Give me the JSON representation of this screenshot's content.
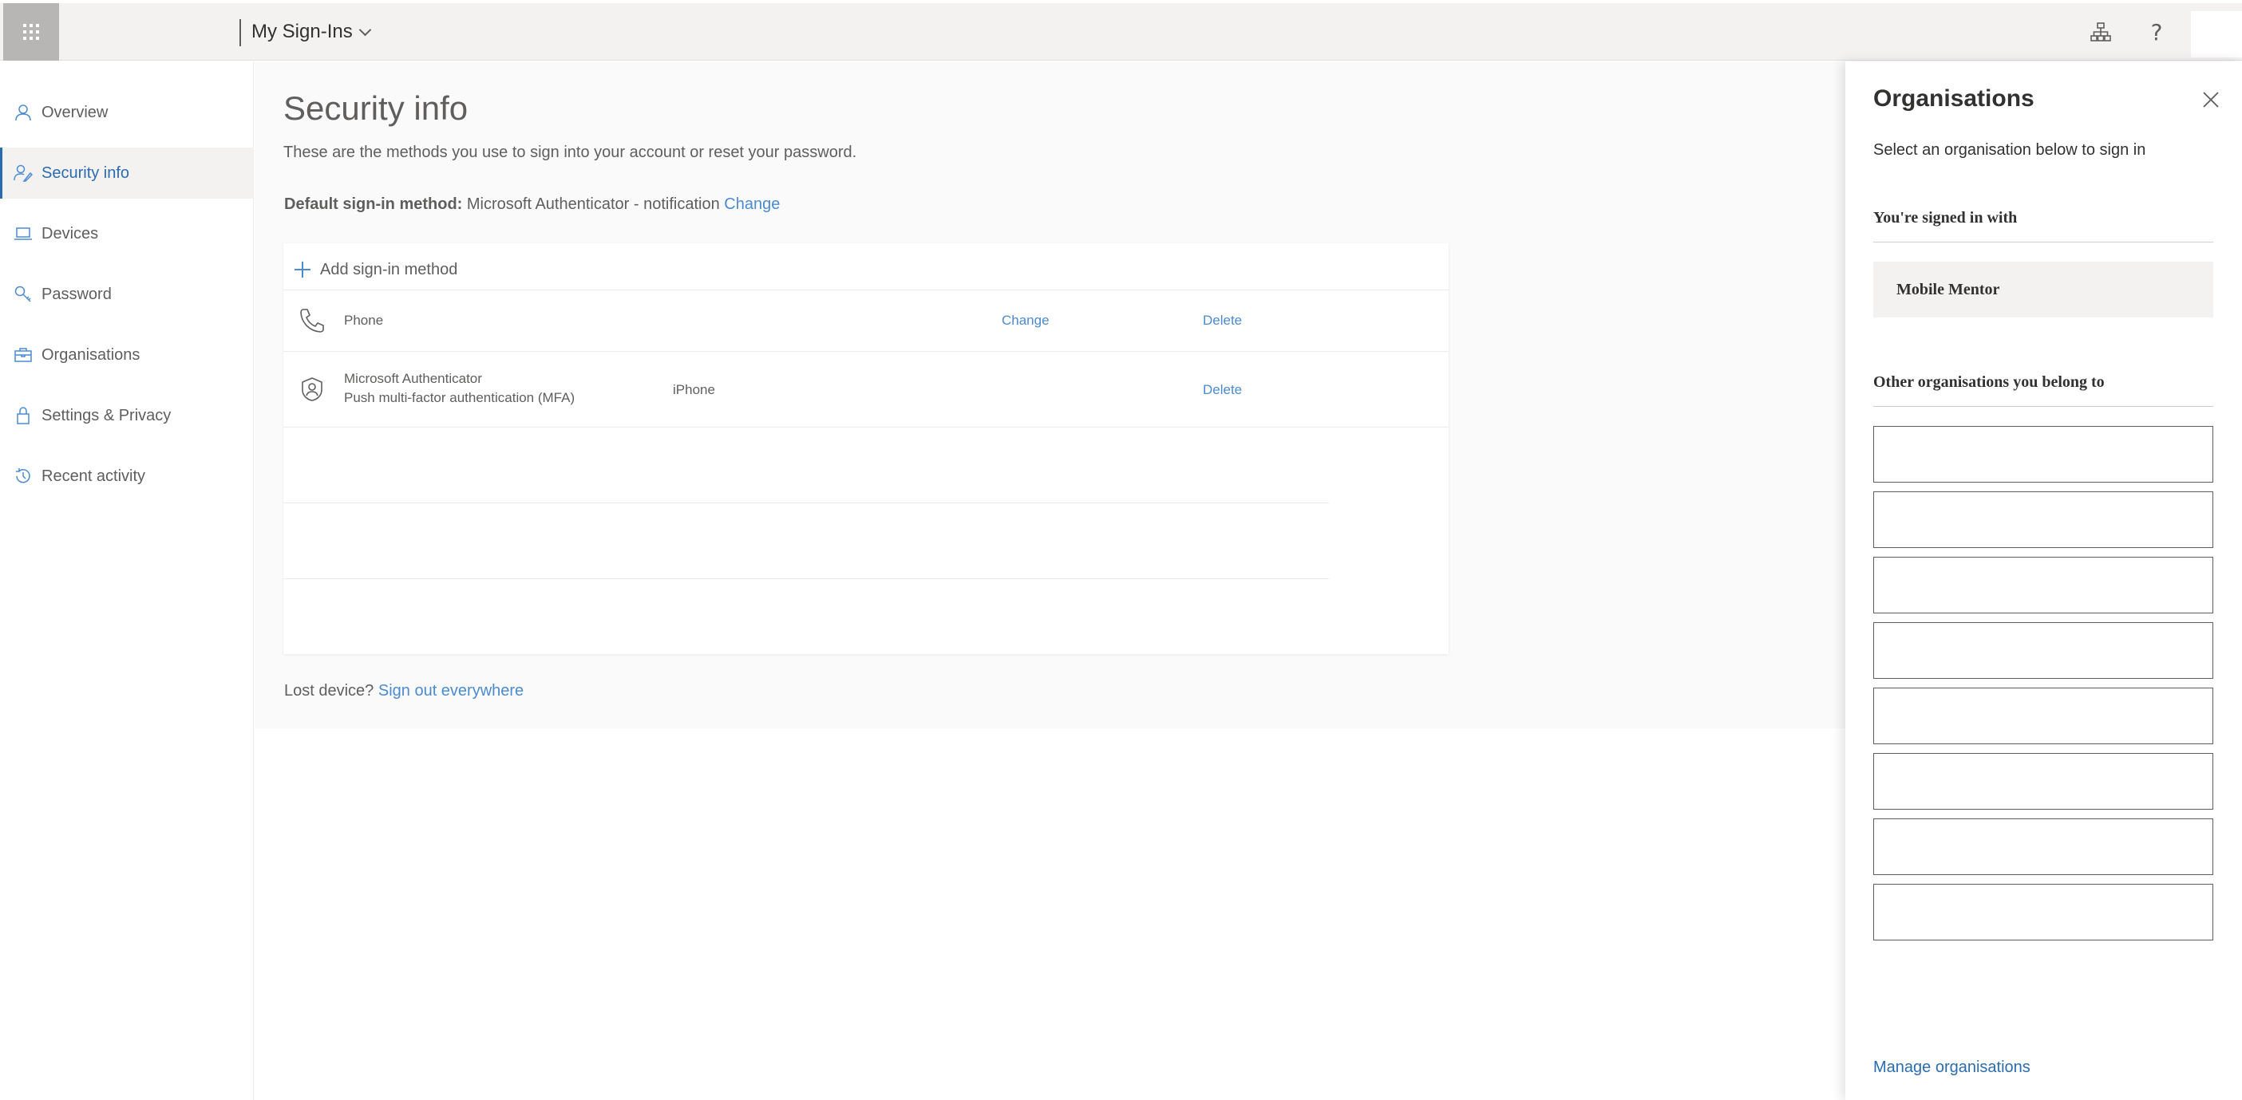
{
  "header": {
    "app_title": "My Sign-Ins",
    "help_glyph": "?",
    "icons": [
      "app-launcher-icon",
      "chevron-down-icon",
      "org-hierarchy-icon",
      "help-icon"
    ]
  },
  "sidebar": {
    "items": [
      {
        "label": "Overview",
        "icon": "person-icon",
        "active": false
      },
      {
        "label": "Security info",
        "icon": "person-key-icon",
        "active": true
      },
      {
        "label": "Devices",
        "icon": "laptop-icon",
        "active": false
      },
      {
        "label": "Password",
        "icon": "key-icon",
        "active": false
      },
      {
        "label": "Organisations",
        "icon": "briefcase-icon",
        "active": false
      },
      {
        "label": "Settings & Privacy",
        "icon": "lock-icon",
        "active": false
      },
      {
        "label": "Recent activity",
        "icon": "history-icon",
        "active": false
      }
    ]
  },
  "main": {
    "title": "Security info",
    "description": "These are the methods you use to sign into your account or reset your password.",
    "default_method": {
      "label": "Default sign-in method:",
      "value": "Microsoft Authenticator - notification",
      "change_link": "Change"
    },
    "add_method_label": "Add sign-in method",
    "methods": [
      {
        "icon": "phone-icon",
        "name": "Phone",
        "detail": "",
        "change": "Change",
        "delete": "Delete"
      },
      {
        "icon": "authenticator-icon",
        "name": "Microsoft Authenticator",
        "subtitle": "Push multi-factor authentication (MFA)",
        "detail": "iPhone",
        "change": "",
        "delete": "Delete"
      }
    ],
    "lost_device": {
      "label": "Lost device?",
      "link": "Sign out everywhere"
    }
  },
  "panel": {
    "title": "Organisations",
    "subtitle": "Select an organisation below to sign in",
    "signed_in_heading": "You're signed in with",
    "current_org": "Mobile Mentor",
    "other_heading": "Other organisations you belong to",
    "other_orgs": [
      "",
      "",
      "",
      "",
      "",
      "",
      "",
      ""
    ],
    "manage_link": "Manage organisations"
  },
  "colors": {
    "accent": "#4b8bd0",
    "active_nav": "#2b6cb0",
    "topbar_bg": "#f3f2f1",
    "waffle_bg": "#b8b6b4"
  }
}
